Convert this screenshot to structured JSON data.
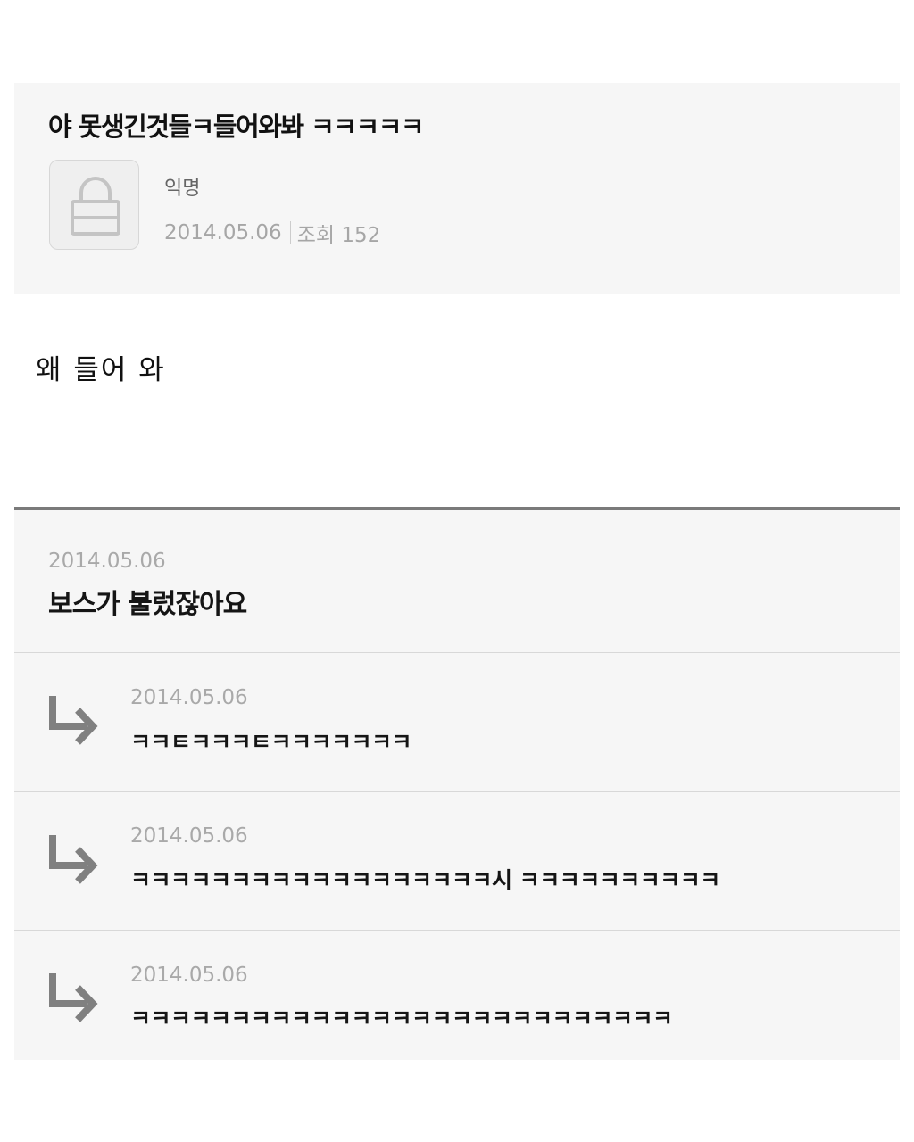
{
  "post": {
    "title": "야 못생긴것들ㅋ들어와봐 ㅋㅋㅋㅋㅋ",
    "author": "익명",
    "date": "2014.05.06",
    "views": "조회 152",
    "body": "왜 들어 와"
  },
  "comments": [
    {
      "date": "2014.05.06",
      "text": "보스가 불렀잖아요"
    },
    {
      "date": "2014.05.06",
      "text": "ㅋㅋㅌㅋㅋㅋㅌㅋㅋㅋㅋㅋㅋㅋ"
    },
    {
      "date": "2014.05.06",
      "text": "ㅋㅋㅋㅋㅋㅋㅋㅋㅋㅋㅋㅋㅋㅋㅋㅋㅋㅋ시   ㅋㅋㅋㅋㅋㅋㅋㅋㅋㅋ"
    },
    {
      "date": "2014.05.06",
      "text": "ㅋㅋㅋㅋㅋㅋㅋㅋㅋㅋㅋㅋㅋㅋㅋㅋㅋㅋㅋㅋㅋㅋㅋㅋㅋㅋㅋ"
    }
  ],
  "icons": {
    "avatar": "lock-icon",
    "reply": "reply-arrow-icon"
  },
  "colors": {
    "header_bg": "#f6f6f6",
    "meta_text": "#a6a6a6",
    "divider": "#7a7a7a",
    "reply_arrow": "#808080"
  }
}
